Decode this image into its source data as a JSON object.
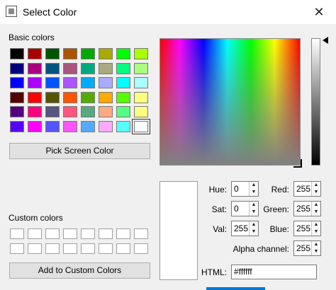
{
  "window": {
    "title": "Select Color",
    "close_glyph": "✕"
  },
  "basic_colors": {
    "label": "Basic colors",
    "swatches": [
      "#000000",
      "#aa0000",
      "#005500",
      "#aa5500",
      "#00aa00",
      "#aaaa00",
      "#00ff00",
      "#aaff00",
      "#00007f",
      "#aa007f",
      "#00557f",
      "#aa557f",
      "#00aa7f",
      "#aaaa7f",
      "#00ff7f",
      "#aaff7f",
      "#0000ff",
      "#aa00ff",
      "#0055ff",
      "#aa55ff",
      "#00aaff",
      "#aaaaff",
      "#00ffff",
      "#aaffff",
      "#550000",
      "#ff0000",
      "#555500",
      "#ff5500",
      "#55aa00",
      "#ffaa00",
      "#55ff00",
      "#ffff7f",
      "#55007f",
      "#ff007f",
      "#55557f",
      "#ff557f",
      "#55aa7f",
      "#ffaa7f",
      "#55ff7f",
      "#ffff7f",
      "#5500ff",
      "#ff00ff",
      "#5555ff",
      "#ff55ff",
      "#55aaff",
      "#ffaaff",
      "#55ffff",
      "#ffffff"
    ],
    "selected_index": 47
  },
  "pick_screen_button": "Pick Screen Color",
  "custom_colors": {
    "label": "Custom colors",
    "count": 16
  },
  "add_custom_button": "Add to Custom Colors",
  "fields": {
    "hue": {
      "label": "Hue:",
      "value": "0"
    },
    "sat": {
      "label": "Sat:",
      "value": "0"
    },
    "val": {
      "label": "Val:",
      "value": "255"
    },
    "red": {
      "label": "Red:",
      "value": "255"
    },
    "green": {
      "label": "Green:",
      "value": "255"
    },
    "blue": {
      "label": "Blue:",
      "value": "255"
    },
    "alpha": {
      "label": "Alpha channel:",
      "value": "255"
    },
    "html": {
      "label": "HTML:",
      "value": "#ffffff"
    }
  },
  "current_color": "#ffffff",
  "icons": {
    "up": "▲",
    "down": "▼"
  }
}
